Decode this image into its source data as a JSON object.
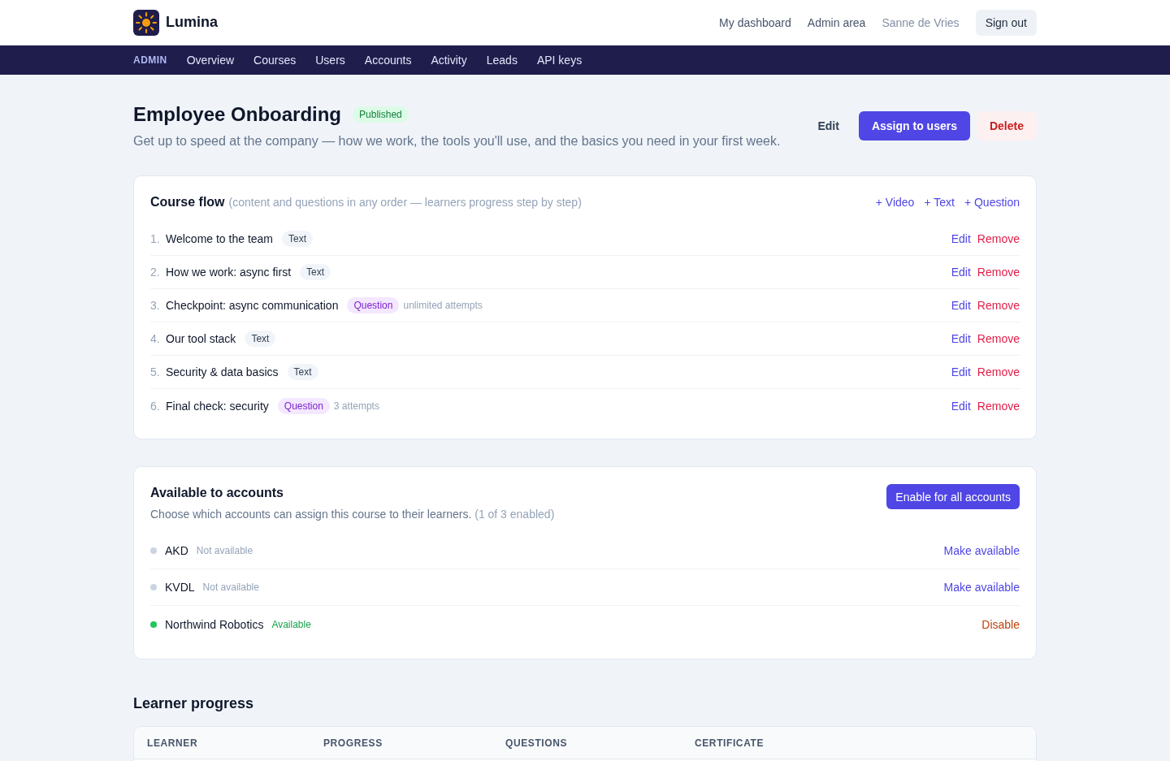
{
  "header": {
    "brand": "Lumina",
    "links": [
      {
        "label": "My dashboard",
        "kind": "link"
      },
      {
        "label": "Admin area",
        "kind": "link"
      },
      {
        "label": "Sanne de Vries",
        "kind": "user"
      },
      {
        "label": "Sign out",
        "kind": "button"
      }
    ]
  },
  "admin_nav": {
    "label": "ADMIN",
    "items": [
      {
        "label": "Overview",
        "selected": false
      },
      {
        "label": "Courses",
        "selected": false
      },
      {
        "label": "Users",
        "selected": false
      },
      {
        "label": "Accounts",
        "selected": false
      },
      {
        "label": "Activity",
        "selected": false
      },
      {
        "label": "Leads",
        "selected": false
      },
      {
        "label": "API keys",
        "selected": false
      }
    ]
  },
  "course": {
    "title": "Employee Onboarding",
    "status": "Published",
    "description": "Get up to speed at the company — how we work, the tools you'll use, and the basics you need in your first week.",
    "actions": [
      {
        "label": "Edit",
        "kind": "plain"
      },
      {
        "label": "Assign to users",
        "kind": "primary"
      },
      {
        "label": "Delete",
        "kind": "danger"
      }
    ]
  },
  "course_flow": {
    "title": "Course flow",
    "hint": "(content and questions in any order — learners progress step by step)",
    "add_actions": [
      "+ Video",
      "+ Text",
      "+ Question"
    ],
    "steps": [
      {
        "number": "1.",
        "title": "Welcome to the team",
        "kind": "text",
        "type_label": "Text",
        "edit": "Edit",
        "remove": "Remove"
      },
      {
        "number": "2.",
        "title": "How we work: async first",
        "kind": "text",
        "type_label": "Text",
        "edit": "Edit",
        "remove": "Remove"
      },
      {
        "number": "3.",
        "title": "Checkpoint: async communication",
        "kind": "question",
        "type_label": "Question",
        "note": "unlimited attempts",
        "edit": "Edit",
        "remove": "Remove"
      },
      {
        "number": "4.",
        "title": "Our tool stack",
        "kind": "text",
        "type_label": "Text",
        "edit": "Edit",
        "remove": "Remove"
      },
      {
        "number": "5.",
        "title": "Security & data basics",
        "kind": "text",
        "type_label": "Text",
        "edit": "Edit",
        "remove": "Remove"
      },
      {
        "number": "6.",
        "title": "Final check: security",
        "kind": "question",
        "type_label": "Question",
        "note": "3 attempts",
        "edit": "Edit",
        "remove": "Remove"
      }
    ]
  },
  "accounts": {
    "title": "Available to accounts",
    "description": "Choose which accounts can assign this course to their learners.",
    "count": "(1 of 3 enabled)",
    "button": "Enable for all accounts",
    "items": [
      {
        "name": "AKD",
        "status": "Not available",
        "available": false,
        "action": "Make available"
      },
      {
        "name": "KVDL",
        "status": "Not available",
        "available": false,
        "action": "Make available"
      },
      {
        "name": "Northwind Robotics",
        "status": "Available",
        "available": true,
        "action": "Disable"
      }
    ]
  },
  "learner_progress": {
    "title": "Learner progress",
    "columns": [
      "LEARNER",
      "PROGRESS",
      "QUESTIONS",
      "CERTIFICATE"
    ]
  }
}
